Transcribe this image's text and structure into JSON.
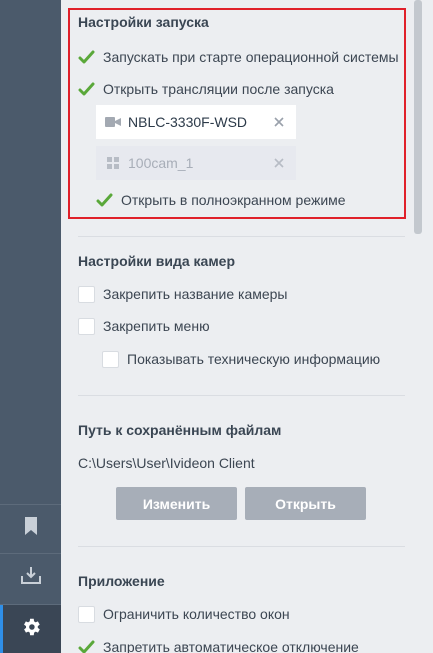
{
  "startup": {
    "title": "Настройки запуска",
    "run_on_os_start": {
      "label": "Запускать при старте операционной системы",
      "checked": true
    },
    "open_streams": {
      "label": "Открыть трансляции после запуска",
      "checked": true
    },
    "streams": [
      {
        "name": "NBLC-3330F-WSD",
        "icon": "camera-icon",
        "active": true
      },
      {
        "name": "100cam_1",
        "icon": "grid-icon",
        "active": false
      }
    ],
    "fullscreen": {
      "label": "Открыть в полноэкранном режиме",
      "checked": true
    }
  },
  "camera_view": {
    "title": "Настройки вида камер",
    "pin_camera_name": {
      "label": "Закрепить название камеры",
      "checked": false
    },
    "pin_menu": {
      "label": "Закрепить меню",
      "checked": false
    },
    "show_tech_info": {
      "label": "Показывать техническую информацию",
      "checked": false
    }
  },
  "saved_files": {
    "title": "Путь к сохранённым файлам",
    "path": "C:\\Users\\User\\Ivideon Client",
    "change_label": "Изменить",
    "open_label": "Открыть"
  },
  "app": {
    "title": "Приложение",
    "limit_windows": {
      "label": "Ограничить количество окон",
      "checked": false
    },
    "disable_auto_off": {
      "label": "Запретить автоматическое отключение",
      "checked": true
    }
  },
  "sidebar": {
    "items": [
      {
        "icon": "bookmark-icon",
        "active": false
      },
      {
        "icon": "download-icon",
        "active": false
      },
      {
        "icon": "gear-icon",
        "active": true
      }
    ]
  },
  "colors": {
    "accent": "#2f8fe8",
    "check": "#5aa83a",
    "highlight_border": "#e0202a",
    "sidebar": "#4b5a6b"
  }
}
